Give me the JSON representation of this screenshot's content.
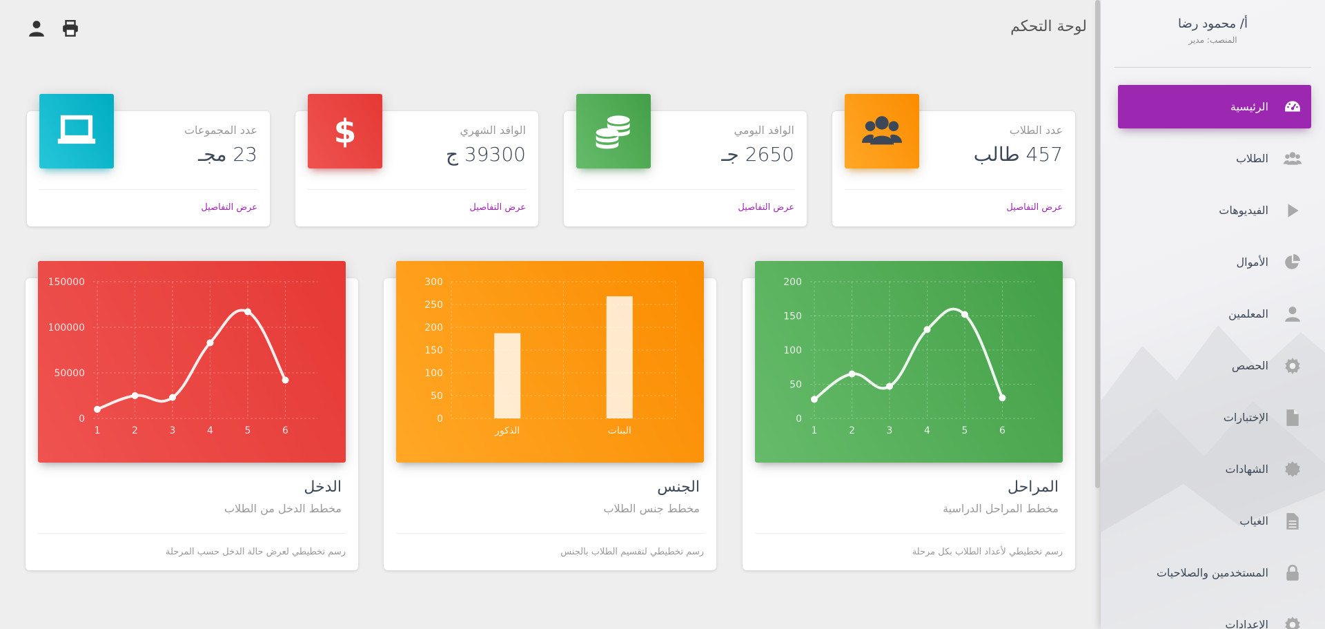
{
  "header": {
    "title": "لوحة التحكم"
  },
  "user": {
    "name": "أ/ محمود رضا",
    "role": "المنصب: مدير"
  },
  "sidebar": {
    "items": [
      {
        "label": "الرئيسية",
        "icon": "dashboard-icon",
        "active": true
      },
      {
        "label": "الطلاب",
        "icon": "users-icon"
      },
      {
        "label": "الفيديوهات",
        "icon": "play-icon"
      },
      {
        "label": "الأموال",
        "icon": "pie-chart-icon"
      },
      {
        "label": "المعلمين",
        "icon": "user-icon"
      },
      {
        "label": "الحصص",
        "icon": "gear-icon"
      },
      {
        "label": "الإختبارات",
        "icon": "file-icon"
      },
      {
        "label": "الشهادات",
        "icon": "certificate-icon"
      },
      {
        "label": "الغياب",
        "icon": "file-text-icon"
      },
      {
        "label": "المستخدمين والصلاحيات",
        "icon": "lock-icon"
      },
      {
        "label": "الإعدادات",
        "icon": "gear-icon"
      }
    ]
  },
  "stats": [
    {
      "label": "عدد الطلاب",
      "value": "457 طالب",
      "link": "عرض التفاصيل",
      "icon": "users-icon",
      "color": "#ff9800"
    },
    {
      "label": "الوافد اليومي",
      "value": "2650 جـ",
      "link": "عرض التفاصيل",
      "icon": "coins-icon",
      "color": "#4caf50"
    },
    {
      "label": "الوافد الشهري",
      "value": "39300 ج",
      "link": "عرض التفاصيل",
      "icon": "dollar-icon",
      "color": "#e53935"
    },
    {
      "label": "عدد المجموعات",
      "value": "23 مجـ",
      "link": "عرض التفاصيل",
      "icon": "laptop-icon",
      "color": "#00bcd4"
    }
  ],
  "charts": [
    {
      "title": "المراحل",
      "subtitle": "مخطط المراحل الدراسية",
      "footer": "رسم تخطيطي لأعداد الطلاب بكل مرحلة",
      "color": "#4caf50"
    },
    {
      "title": "الجنس",
      "subtitle": "مخطط جنس الطلاب",
      "footer": "رسم تخطيطي لتقسيم الطلاب بالجنس",
      "color": "#ff9800"
    },
    {
      "title": "الدخل",
      "subtitle": "مخطط الدخل من الطلاب",
      "footer": "رسم تخطيطي لعرض حالة الدخل حسب المرحلة",
      "color": "#e53935"
    }
  ],
  "chart_data": [
    {
      "type": "line",
      "x": [
        "1",
        "2",
        "3",
        "4",
        "5",
        "6"
      ],
      "values": [
        28,
        65,
        47,
        130,
        152,
        30
      ],
      "ylim": [
        0,
        200
      ],
      "yticks": [
        0,
        50,
        100,
        150,
        200
      ]
    },
    {
      "type": "bar",
      "categories": [
        "البنات",
        "الذكور"
      ],
      "values": [
        268,
        187
      ],
      "ylim": [
        0,
        300
      ],
      "yticks": [
        0,
        50,
        100,
        150,
        200,
        250,
        300
      ]
    },
    {
      "type": "line",
      "x": [
        "1",
        "2",
        "3",
        "4",
        "5",
        "6"
      ],
      "values": [
        10000,
        25000,
        23000,
        83000,
        117000,
        42000
      ],
      "ylim": [
        0,
        150000
      ],
      "yticks": [
        0,
        50000,
        100000,
        150000
      ]
    }
  ]
}
